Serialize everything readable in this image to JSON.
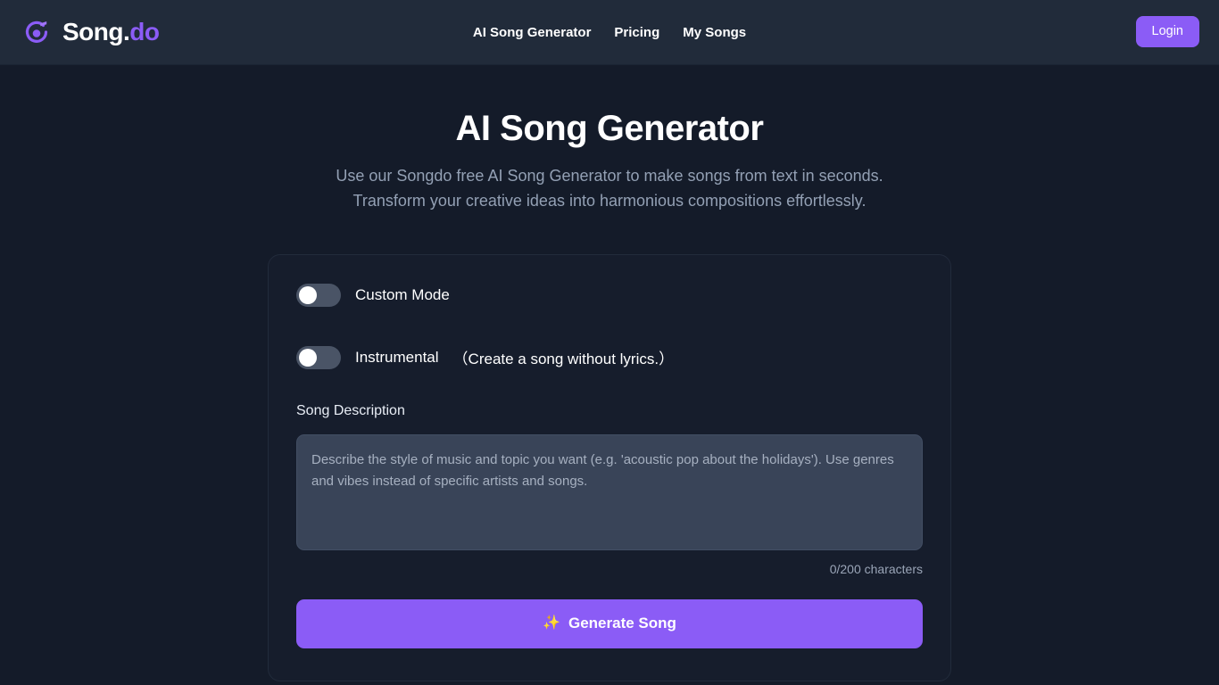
{
  "header": {
    "brand": {
      "name_primary": "Song.",
      "name_accent": "do",
      "icon": "music-note-circle-icon"
    },
    "nav": [
      {
        "label": "AI Song Generator"
      },
      {
        "label": "Pricing"
      },
      {
        "label": "My Songs"
      }
    ],
    "login_label": "Login"
  },
  "hero": {
    "title": "AI Song Generator",
    "subtitle_line1": "Use our Songdo free AI Song Generator to make songs from text in seconds.",
    "subtitle_line2": "Transform your creative ideas into harmonious compositions effortlessly."
  },
  "form": {
    "custom_mode": {
      "label": "Custom Mode",
      "state": "off"
    },
    "instrumental": {
      "label": "Instrumental",
      "hint": "（Create a song without lyrics.）",
      "state": "off"
    },
    "description": {
      "label": "Song Description",
      "value": "",
      "placeholder": "Describe the style of music and topic you want (e.g. 'acoustic pop about the holidays'). Use genres and vibes instead of specific artists and songs.",
      "counter": "0/200 characters"
    },
    "generate": {
      "label": "Generate Song",
      "icon": "sparkles-icon",
      "glyph": "✨"
    }
  },
  "colors": {
    "accent_purple": "#8b5cf6",
    "header_bg": "#212b3a",
    "page_bg": "#141b29",
    "card_bg": "#161d2c",
    "textarea_bg": "#394458",
    "switch_track": "#4a5466"
  }
}
